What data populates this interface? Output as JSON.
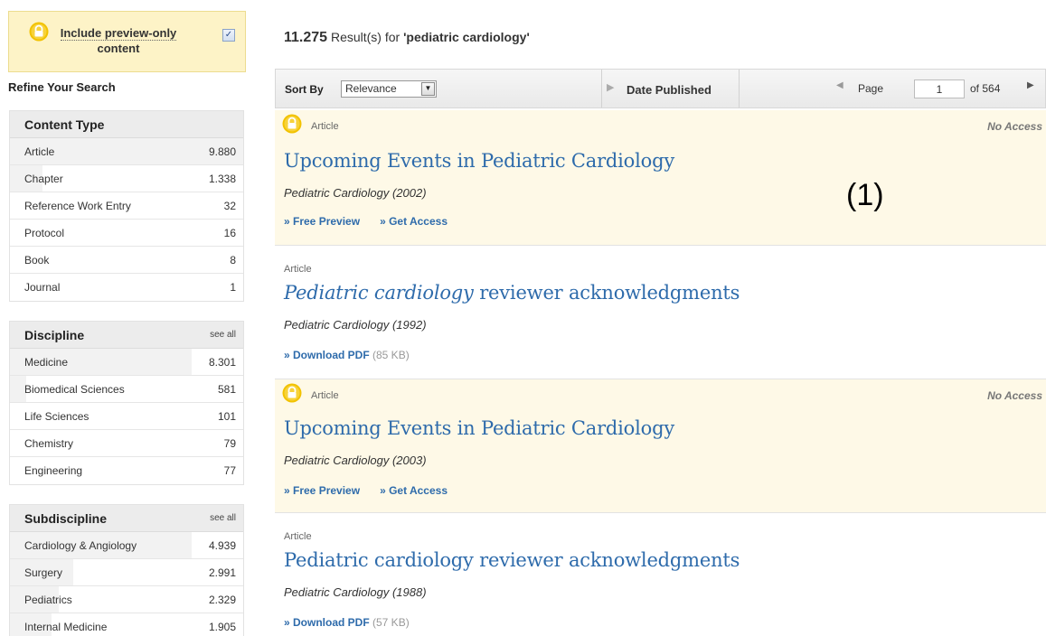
{
  "sidebar": {
    "preview_label_line1": "Include preview-only",
    "preview_label_line2": "content",
    "preview_checked": "✓",
    "refine_title": "Refine Your Search",
    "facets": [
      {
        "title": "Content Type",
        "see_all": "",
        "items": [
          {
            "label": "Article",
            "count": "9.880",
            "bar": 1.0
          },
          {
            "label": "Chapter",
            "count": "1.338",
            "bar": 0.14
          },
          {
            "label": "Reference Work Entry",
            "count": "32",
            "bar": 0.0
          },
          {
            "label": "Protocol",
            "count": "16",
            "bar": 0.0
          },
          {
            "label": "Book",
            "count": "8",
            "bar": 0.0
          },
          {
            "label": "Journal",
            "count": "1",
            "bar": 0.0
          }
        ]
      },
      {
        "title": "Discipline",
        "see_all": "see all",
        "items": [
          {
            "label": "Medicine",
            "count": "8.301",
            "bar": 0.78
          },
          {
            "label": "Biomedical Sciences",
            "count": "581",
            "bar": 0.07
          },
          {
            "label": "Life Sciences",
            "count": "101",
            "bar": 0.0
          },
          {
            "label": "Chemistry",
            "count": "79",
            "bar": 0.0
          },
          {
            "label": "Engineering",
            "count": "77",
            "bar": 0.0
          }
        ]
      },
      {
        "title": "Subdiscipline",
        "see_all": "see all",
        "items": [
          {
            "label": "Cardiology & Angiology",
            "count": "4.939",
            "bar": 0.78
          },
          {
            "label": "Surgery",
            "count": "2.991",
            "bar": 0.27
          },
          {
            "label": "Pediatrics",
            "count": "2.329",
            "bar": 0.21
          },
          {
            "label": "Internal Medicine",
            "count": "1.905",
            "bar": 0.18
          }
        ]
      }
    ]
  },
  "main": {
    "result_count": "11.275",
    "result_text": " Result(s) for ",
    "query": "'pediatric cardiology'",
    "toolbar": {
      "sort_label": "Sort By",
      "sort_value": "Relevance",
      "sort_arrow": "▼",
      "date_label": "Date Published",
      "date_icon": "▶",
      "prev_icon": "◀",
      "page_label": "Page",
      "page_value": "1",
      "of_label": "of 564",
      "next_icon": "▶"
    },
    "results": [
      {
        "type": "Article",
        "locked": true,
        "access": "No Access",
        "title_italic": "",
        "title": "Upcoming Events in Pediatric Cardiology",
        "source": "Pediatric Cardiology (2002)",
        "link1": "» Free Preview",
        "link2": "» Get Access",
        "size": "",
        "annotation": "(1)"
      },
      {
        "type": "Article",
        "locked": false,
        "access": "",
        "title_italic": "Pediatric cardiology",
        "title": " reviewer acknowledgments",
        "source": "Pediatric Cardiology (1992)",
        "link1": "» Download PDF",
        "link2": "",
        "size": " (85 KB)",
        "annotation": ""
      },
      {
        "type": "Article",
        "locked": true,
        "access": "No Access",
        "title_italic": "",
        "title": "Upcoming Events in Pediatric Cardiology",
        "source": "Pediatric Cardiology (2003)",
        "link1": "» Free Preview",
        "link2": "» Get Access",
        "size": "",
        "annotation": ""
      },
      {
        "type": "Article",
        "locked": false,
        "access": "",
        "title_italic": "",
        "title": "Pediatric cardiology reviewer acknowledgments",
        "source": "Pediatric Cardiology (1988)",
        "link1": "» Download PDF",
        "link2": "",
        "size": " (57 KB)",
        "annotation": ""
      }
    ]
  },
  "colors": {
    "accent_link": "#2e6bab",
    "locked_bg": "#fef9e7",
    "lock_icon": "#f2c200"
  },
  "icons": [
    "lock-icon",
    "checkbox-icon",
    "dropdown-arrow-icon",
    "sort-direction-icon",
    "prev-page-icon",
    "next-page-icon"
  ]
}
